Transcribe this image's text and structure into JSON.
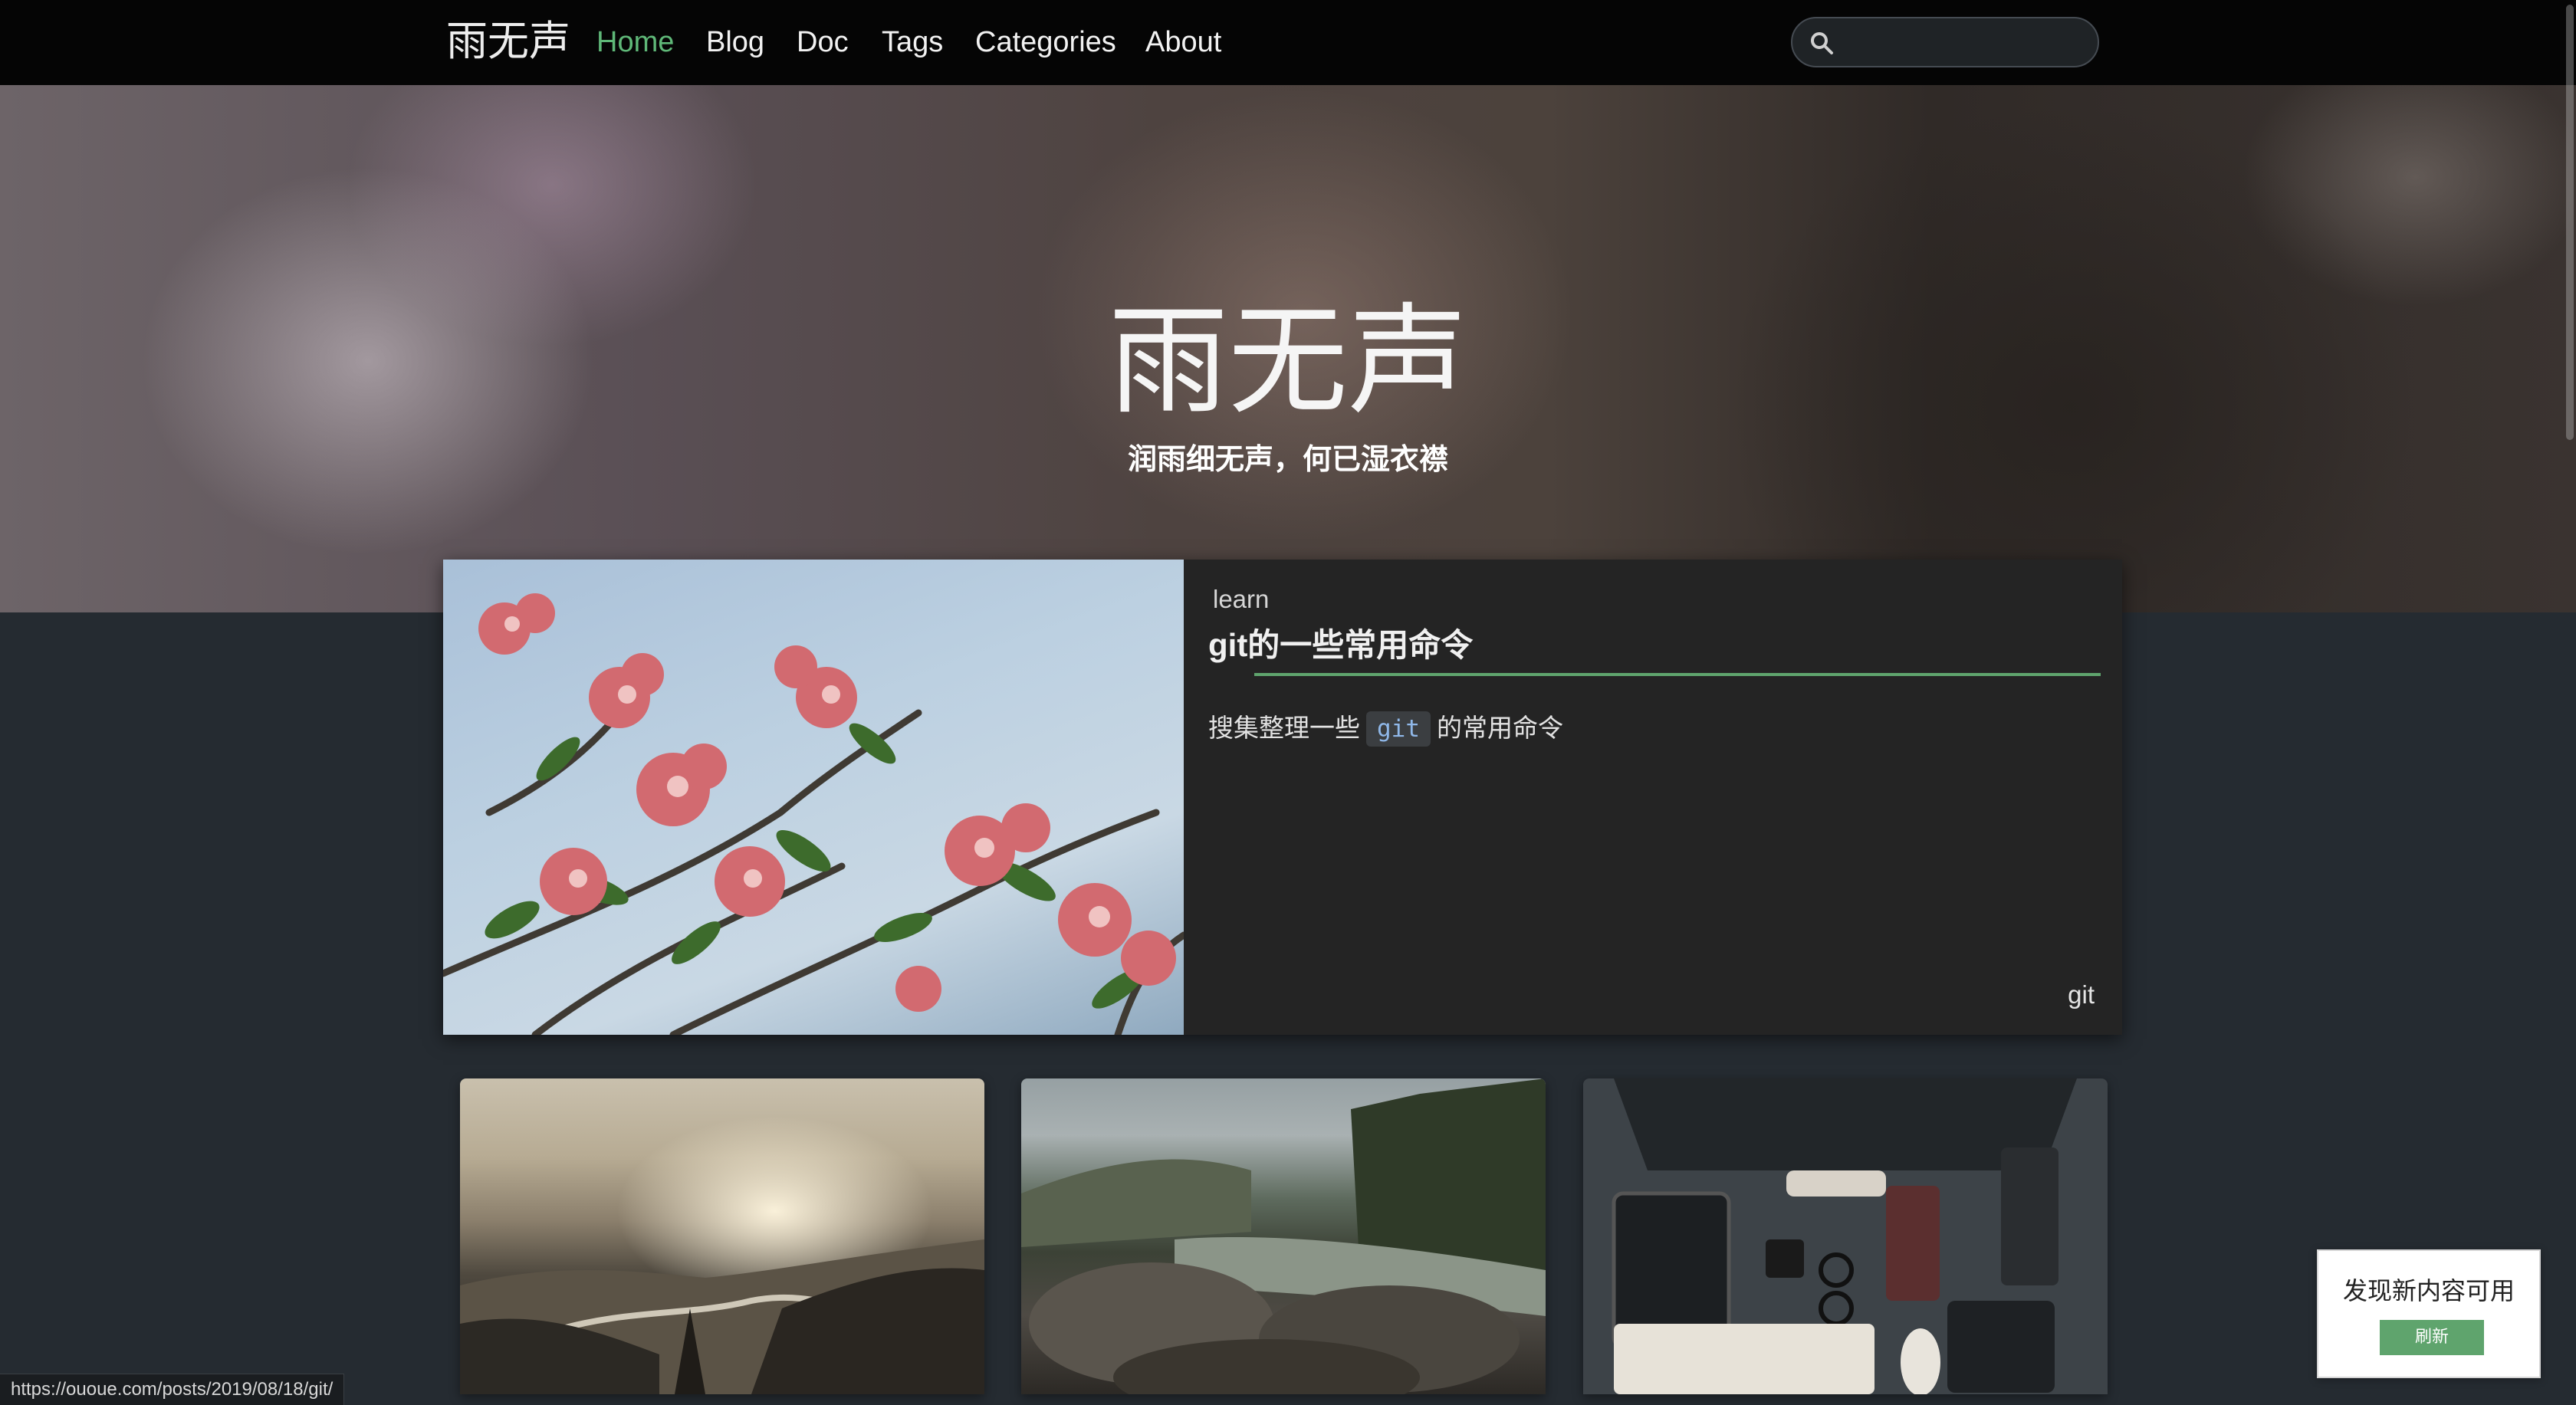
{
  "navbar": {
    "brand": "雨无声",
    "items": [
      {
        "label": "Home",
        "active": true
      },
      {
        "label": "Blog",
        "active": false
      },
      {
        "label": "Doc",
        "active": false
      },
      {
        "label": "Tags",
        "active": false
      },
      {
        "label": "Categories",
        "active": false
      },
      {
        "label": "About",
        "active": false
      }
    ],
    "search": {
      "placeholder": "",
      "icon": "search-icon"
    }
  },
  "hero": {
    "title": "雨无声",
    "subtitle": "润雨细无声，何已湿衣襟"
  },
  "featured_post": {
    "category": "learn",
    "title": "git的一些常用命令",
    "excerpt_before": "搜集整理一些",
    "excerpt_code": "git",
    "excerpt_after": "的常用命令",
    "tag": "git"
  },
  "status_bar": {
    "url": "https://ououe.com/posts/2019/08/18/git/"
  },
  "toast": {
    "message": "发现新内容可用",
    "button_label": "刷新"
  },
  "colors": {
    "accent": "#5fb878",
    "rule": "#5fa46d",
    "navbar_bg": "#050505",
    "page_bg": "#252b31",
    "card_bg": "#242424"
  }
}
